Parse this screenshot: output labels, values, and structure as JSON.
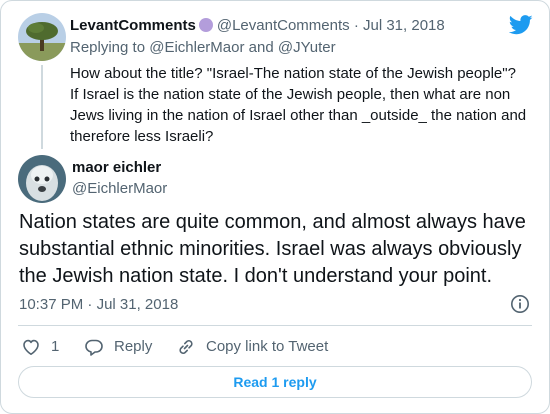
{
  "parent_tweet": {
    "display_name": "LevantComments",
    "handle": "@LevantComments",
    "separator": "·",
    "date": "Jul 31, 2018",
    "replying_prefix": "Replying to",
    "replying_to_1": "@EichlerMaor",
    "replying_and": "and",
    "replying_to_2": "@JYuter",
    "body_lines": [
      "How about the title? \"Israel-The nation state of the Jewish people\"?",
      "If Israel is the nation state of the Jewish people, then what are non",
      "Jews living in the nation of Israel other than _outside_ the nation and",
      "therefore less Israeli?"
    ]
  },
  "main_tweet": {
    "display_name": "maor eichler",
    "handle": "@EichlerMaor",
    "body_lines": [
      "Nation states are quite common, and almost always have",
      "substantial ethnic minorities. Israel was always obviously",
      "the Jewish nation state. I don't understand your point."
    ],
    "time": "10:37 PM",
    "separator": "·",
    "date": "Jul 31, 2018"
  },
  "actions": {
    "like_count": "1",
    "reply_label": "Reply",
    "copy_link_label": "Copy link to Tweet"
  },
  "read_reply_label": "Read 1 reply",
  "icons": [
    "twitter-bird-icon",
    "verified-badge-icon",
    "info-icon",
    "heart-icon",
    "reply-icon",
    "link-icon"
  ],
  "colors": {
    "brand": "#1d9bf0",
    "text": "#0f1419",
    "muted": "#536471",
    "border": "#cfd9de",
    "badge": "#b39ddb"
  }
}
